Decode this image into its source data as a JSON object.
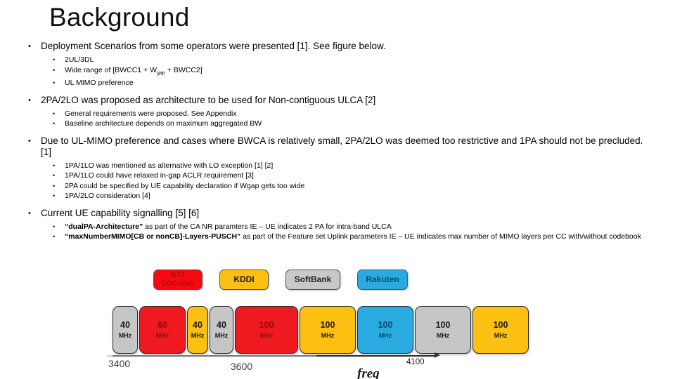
{
  "slide": {
    "title": "Background"
  },
  "content": [
    {
      "level": 1,
      "text": "Deployment Scenarios from some operators were presented [1]. See figure below."
    },
    {
      "level": 2,
      "text": "2UL/3DL"
    },
    {
      "level": 2,
      "text": "Wide range of [BWCC1 + Wgap + BWCC2]",
      "has_subscript": true,
      "pre": "Wide range of [BWCC1 + W",
      "sub": "gap",
      "post": " + BWCC2]"
    },
    {
      "level": 2,
      "text": "UL MIMO preference"
    },
    {
      "level": 1,
      "text": "2PA/2LO was proposed as architecture to be used for Non-contiguous ULCA [2]"
    },
    {
      "level": 2,
      "text": "General requirements were proposed. See Appendix"
    },
    {
      "level": 2,
      "text": "Baseline architecture depends on maximum aggregated BW"
    },
    {
      "level": 1,
      "text": "Due to UL-MIMO preference and cases where BWCA is relatively small, 2PA/2LO was deemed too restrictive and 1PA should not be precluded. [1]"
    },
    {
      "level": 2,
      "text": "1PA/1LO was mentioned as alternative with LO exception [1] [2]"
    },
    {
      "level": 2,
      "text": "1PA/1LO could have relaxed in-gap ACLR requirement [3]"
    },
    {
      "level": 2,
      "text": "2PA could be specified by UE capability declaration if Wgap gets too wide"
    },
    {
      "level": 2,
      "text": "1PA/2LO consideration [4]"
    },
    {
      "level": 1,
      "text": "Current UE capability signalling [5] [6]"
    },
    {
      "level": 2,
      "bold_part": "“dualPA-Architecture”",
      "rest": " as part of the CA NR paramters IE – UE indicates 2 PA for intra-band ULCA"
    },
    {
      "level": 2,
      "bold_part": "“maxNumberMIMO[CB or nonCB]-Layers-PUSCH”",
      "rest": " as part of the Feature set Uplink parameters IE – UE indicates max number of MIMO layers per CC with/without codebook"
    }
  ],
  "bullets": {
    "b1": "Deployment Scenarios from some operators were presented [1]. See figure below.",
    "b1s1": "2UL/3DL",
    "b1s2_pre": "Wide range of [BWCC1 + W",
    "b1s2_sub": "gap",
    "b1s2_post": " + BWCC2]",
    "b1s3": "UL MIMO preference",
    "b2": "2PA/2LO was proposed as architecture to be used for Non-contiguous ULCA [2]",
    "b2s1": "General requirements were proposed. See Appendix",
    "b2s2": "Baseline architecture depends on maximum aggregated BW",
    "b3": "Due to UL-MIMO preference and cases where BWCA is relatively small, 2PA/2LO was deemed too restrictive and 1PA should not be precluded. [1]",
    "b3s1": "1PA/1LO was mentioned as alternative with LO exception [1] [2]",
    "b3s2": "1PA/1LO could have relaxed in-gap ACLR requirement [3]",
    "b3s3": "2PA could be specified by UE capability declaration if Wgap gets too wide",
    "b3s4": "1PA/2LO consideration [4]",
    "b4": "Current UE capability signalling [5] [6]",
    "b4s1_bold": "“dualPA-Architecture”",
    "b4s1_rest": " as part of the CA NR paramters IE – UE indicates 2 PA for intra-band ULCA",
    "b4s2_bold": "“maxNumberMIMO[CB or nonCB]-Layers-PUSCH”",
    "b4s2_rest": " as part of the Feature set Uplink parameters IE – UE indicates max number of MIMO layers per CC with/without codebook",
    "marker": "•"
  },
  "operator_logos": [
    {
      "name": "NTT DOCOMO",
      "line1": "NTT",
      "line2": "DOCOMO",
      "color": "#f40b12",
      "text_color": "#b00b10"
    },
    {
      "name": "KDDI",
      "line1": "KDDI",
      "color": "#fbc011",
      "text_color": "#1a1a1a"
    },
    {
      "name": "SoftBank",
      "line1": "SoftBank",
      "color": "#c8c8c8",
      "text_color": "#222222"
    },
    {
      "name": "Rakuten",
      "line1": "Rakuten",
      "color": "#29abe2",
      "text_color": "#104a66"
    }
  ],
  "chart_data": {
    "type": "bar",
    "title": "",
    "xlabel": "freq",
    "ylabel": "",
    "axis_ticks": [
      "3400",
      "3600",
      "4100"
    ],
    "unit": "MHz",
    "categories": [
      "40",
      "80",
      "40",
      "40",
      "100",
      "100",
      "100",
      "100",
      "100"
    ],
    "values": [
      40,
      80,
      40,
      40,
      100,
      100,
      100,
      100,
      100
    ],
    "colors": [
      "#c6c6c6",
      "#ef1a1f",
      "#fbc011",
      "#c6c6c6",
      "#ef1a1f",
      "#fbc011",
      "#29abe2",
      "#c6c6c6",
      "#fbc011"
    ],
    "text_colors": [
      "#1a1a1a",
      "#8e0c10",
      "#1a1a1a",
      "#1a1a1a",
      "#8e0c10",
      "#1a1a1a",
      "#0d4660",
      "#1a1a1a",
      "#1a1a1a"
    ],
    "block_widths": [
      36,
      66,
      30,
      34,
      90,
      80,
      80,
      80,
      80
    ],
    "grid": false,
    "legend": "none"
  },
  "axis": {
    "tick_start": "3400",
    "tick_mid": "3600",
    "tick_end": "4100",
    "label": "freq"
  }
}
